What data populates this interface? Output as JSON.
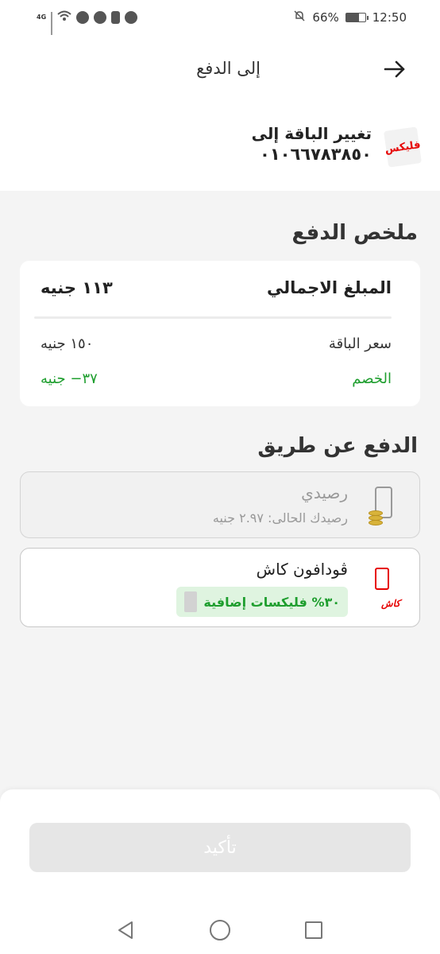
{
  "status_bar": {
    "network": "4G",
    "battery_text": "66%",
    "battery_level": 0.66,
    "time": "12:50"
  },
  "header": {
    "title": "إلى الدفع"
  },
  "package": {
    "logo_text": "فليكس",
    "title": "تغيير الباقة إلى",
    "number": "٠١٠٦٦٧٨٣٨٥٠"
  },
  "summary": {
    "title": "ملخص الدفع",
    "total_label": "المبلغ الاجمالي",
    "total_value": "١١٣ جنيه",
    "price_label": "سعر الباقة",
    "price_value": "١٥٠ جنيه",
    "discount_label": "الخصم",
    "discount_value": "٣٧− جنيه"
  },
  "payment": {
    "title": "الدفع عن طريق",
    "balance": {
      "name": "رصيدي",
      "subtitle": "رصيدك الحالى: ٢.٩٧ جنيه"
    },
    "cash": {
      "name": "ڤودافون كاش",
      "logo_text": "كاش",
      "bonus": "٣٠% فليكسات إضافية"
    }
  },
  "confirm": {
    "label": "تأكيد"
  },
  "colors": {
    "accent": "#e60000",
    "success": "#1e9e2e",
    "disabled": "#e6e6e6"
  },
  "icons": [
    "back-arrow-icon",
    "phone-coins-icon",
    "vodafone-cash-icon",
    "nav-back-icon",
    "nav-home-icon",
    "nav-recent-icon"
  ]
}
